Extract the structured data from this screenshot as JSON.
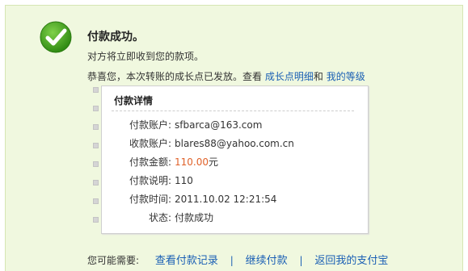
{
  "status": {
    "title": "付款成功。",
    "subtitle": "对方将立即收到您的款项。",
    "growth_text": "恭喜您，本次转账的成长点已发放。查看",
    "growth_link": "成长点明细",
    "growth_and": "和",
    "level_link": "我的等级",
    "icon": "check-circle-icon",
    "icon_color": "#3a9a1a"
  },
  "details": {
    "heading": "付款详情",
    "rows": [
      {
        "label": "付款账户:",
        "value": "sfbarca@163.com"
      },
      {
        "label": "收款账户:",
        "value": "blares88@yahoo.com.cn"
      },
      {
        "label": "付款金额:",
        "amount": "110.00",
        "unit": "元"
      },
      {
        "label": "付款说明:",
        "value": "110"
      },
      {
        "label": "付款时间:",
        "value": "2011.10.02 12:21:54"
      },
      {
        "label": "状态:",
        "value": "付款成功"
      }
    ]
  },
  "footer": {
    "prompt": "您可能需要:",
    "links": [
      "查看付款记录",
      "继续付款",
      "返回我的支付宝"
    ],
    "separator": "|"
  },
  "colors": {
    "panel_bg": "#f0f8df",
    "link": "#1a5fb4",
    "amount": "#e0622a"
  }
}
